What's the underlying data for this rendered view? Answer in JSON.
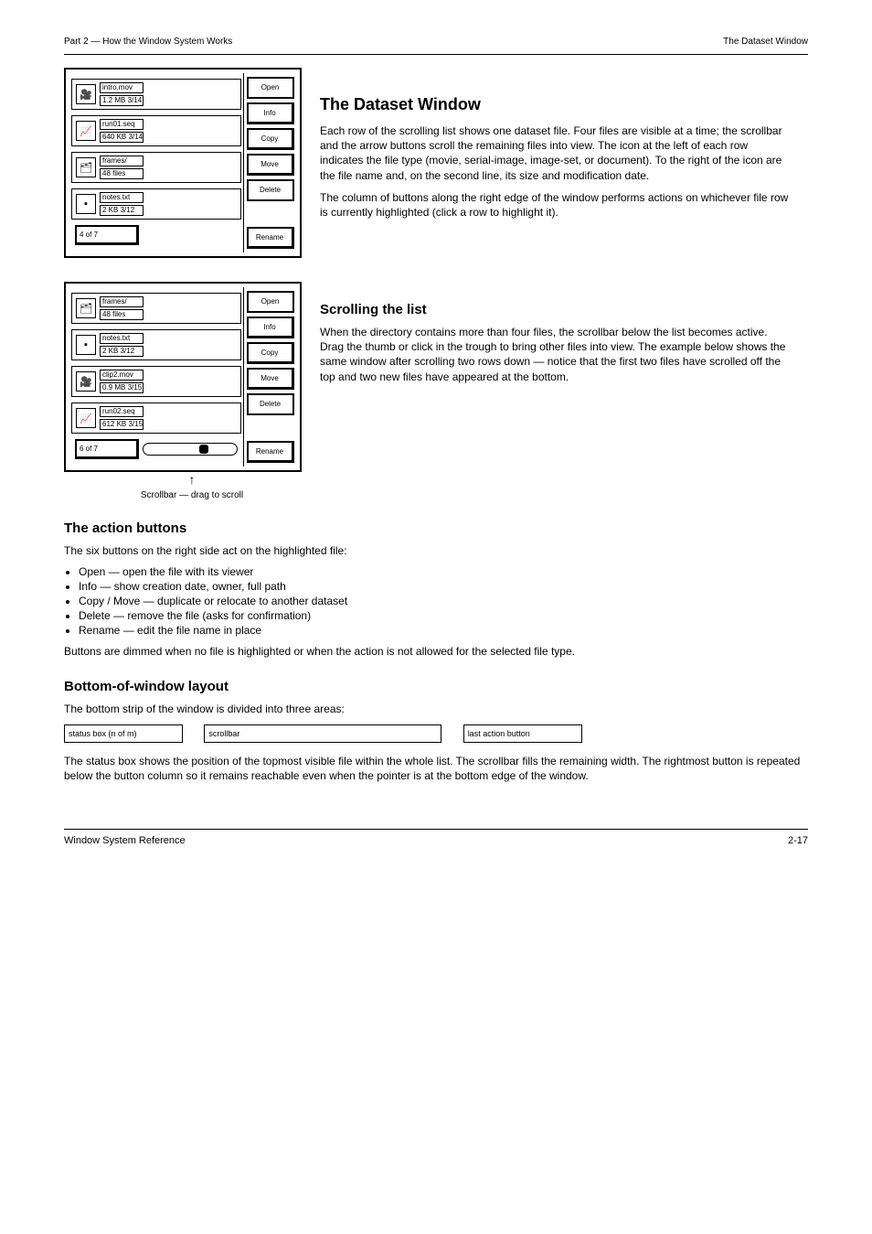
{
  "header": {
    "left": "Part 2 — How the Window System Works",
    "title": "The Dataset Window"
  },
  "intro": {
    "p1": "Each row of the scrolling list shows one dataset file. Four files are visible at a time; the scrollbar and the arrow buttons scroll the remaining files into view. The icon at the left of each row indicates the file type (movie, serial-image, image-set, or document). To the right of the icon are the file name and, on the second line, its size and modification date.",
    "p2": "The column of buttons along the right edge of the window performs actions on whichever file row is currently highlighted (click a row to highlight it)."
  },
  "panel1": {
    "rows": [
      {
        "icon": "movie",
        "name": "intro.mov",
        "meta": "1.2 MB  3/14"
      },
      {
        "icon": "serial",
        "name": "run01.seq",
        "meta": "640 KB  3/14"
      },
      {
        "icon": "imgset",
        "name": "frames/",
        "meta": "48 files"
      },
      {
        "icon": "doc",
        "name": "notes.txt",
        "meta": "2 KB  3/12"
      }
    ],
    "buttons": [
      "Open",
      "Info",
      "Copy",
      "Move",
      "Delete",
      "Rename"
    ],
    "status": "4 of 7"
  },
  "scroll_section": {
    "title": "Scrolling the list",
    "p1": "When the directory contains more than four files, the scrollbar below the list becomes active. Drag the thumb or click in the trough to bring other files into view. The example below shows the same window after scrolling two rows down — notice that the first two files have scrolled off the top and two new files have appeared at the bottom.",
    "caption": "Scrollbar — drag to scroll"
  },
  "panel2": {
    "rows": [
      {
        "icon": "imgset",
        "name": "frames/",
        "meta": "48 files"
      },
      {
        "icon": "doc",
        "name": "notes.txt",
        "meta": "2 KB  3/12"
      },
      {
        "icon": "movie",
        "name": "clip2.mov",
        "meta": "0.9 MB  3/15"
      },
      {
        "icon": "serial",
        "name": "run02.seq",
        "meta": "612 KB  3/15"
      }
    ],
    "buttons": [
      "Open",
      "Info",
      "Copy",
      "Move",
      "Delete",
      "Rename"
    ],
    "status": "6 of 7",
    "thumb_left_pct": 60
  },
  "buttons_section": {
    "title": "The action buttons",
    "p": "The six buttons on the right side act on the highlighted file:",
    "items": [
      "Open — open the file with its viewer",
      "Info — show creation date, owner, full path",
      "Copy / Move — duplicate or relocate to another dataset",
      "Delete — remove the file (asks for confirmation)",
      "Rename — edit the file name in place"
    ],
    "p2": "Buttons are dimmed when no file is highlighted or when the action is not allowed for the selected file type."
  },
  "layout_section": {
    "title": "Bottom-of-window layout",
    "p": "The bottom strip of the window is divided into three areas:",
    "labels": {
      "status": "status box (n of m)",
      "scroll": "scrollbar",
      "last": "last action button"
    },
    "p2": "The status box shows the position of the topmost visible file within the whole list. The scrollbar fills the remaining width. The rightmost button is repeated below the button column so it remains reachable even when the pointer is at the bottom edge of the window."
  },
  "footer": {
    "page": "2-17",
    "doc": "Window System Reference"
  },
  "icons": {
    "movie": "🎥",
    "serial": "📈",
    "imgset": "🗂",
    "doc": "▪"
  }
}
